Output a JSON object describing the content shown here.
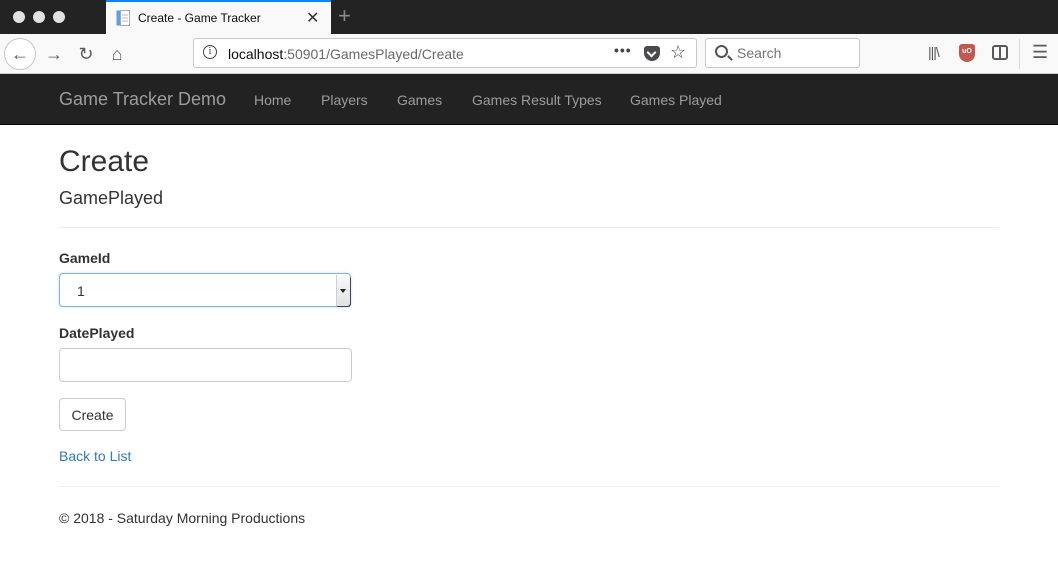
{
  "browser": {
    "tab_title": "Create - Game Tracker",
    "url_host": "localhost",
    "url_rest": ":50901/GamesPlayed/Create",
    "search_placeholder": "Search",
    "icons": {
      "back": "arrow-left-icon",
      "forward": "arrow-right-icon",
      "reload": "reload-icon",
      "home": "home-icon",
      "info": "info-icon",
      "page_actions": "more-dots-icon",
      "pocket": "pocket-icon",
      "bookmark": "star-icon",
      "library": "library-icon",
      "ublock": "ublock-icon",
      "sidebar": "sidebar-icon",
      "menu": "hamburger-icon"
    },
    "accent_color": "#0a84ff"
  },
  "site": {
    "brand": "Game Tracker Demo",
    "nav": [
      {
        "label": "Home"
      },
      {
        "label": "Players"
      },
      {
        "label": "Games"
      },
      {
        "label": "Games Result Types"
      },
      {
        "label": "Games Played"
      }
    ]
  },
  "page": {
    "title": "Create",
    "subtitle": "GamePlayed",
    "fields": {
      "game_id_label": "GameId",
      "game_id_value": "1",
      "date_played_label": "DatePlayed",
      "date_played_value": ""
    },
    "submit_label": "Create",
    "back_link": "Back to List",
    "link_color": "#337ab7"
  },
  "footer": {
    "text": "© 2018 - Saturday Morning Productions"
  }
}
